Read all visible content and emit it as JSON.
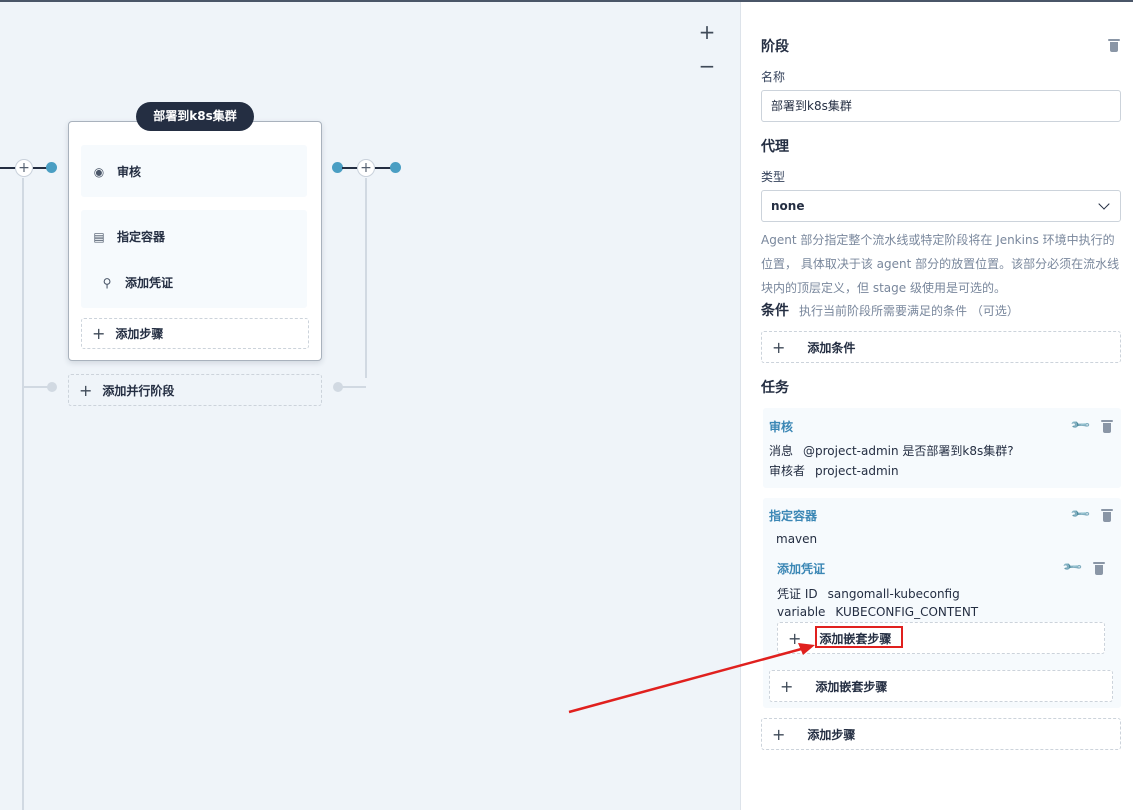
{
  "canvas": {
    "zoom_in": "+",
    "zoom_out": "−",
    "stage": {
      "title": "部署到k8s集群",
      "steps": [
        {
          "label": "审核",
          "icon": "review-icon"
        },
        {
          "label": "指定容器",
          "icon": "container-icon"
        },
        {
          "label": "添加凭证",
          "icon": "key-icon"
        }
      ],
      "add_step": "添加步骤"
    },
    "add_parallel_stage": "添加并行阶段"
  },
  "panel": {
    "section_stage": "阶段",
    "name_label": "名称",
    "name_value": "部署到k8s集群",
    "section_agent": "代理",
    "type_label": "类型",
    "type_value": "none",
    "agent_description": "Agent 部分指定整个流水线或特定阶段将在 Jenkins 环境中执行的位置， 具体取决于该 agent 部分的放置位置。该部分必须在流水线块内的顶层定义，但 stage 级使用是可选的。",
    "section_condition": "条件",
    "condition_hint": "执行当前阶段所需要满足的条件 （可选）",
    "add_condition": "添加条件",
    "section_tasks": "任务",
    "tasks": {
      "review": {
        "title": "审核",
        "message_key": "消息",
        "message_value": "@project-admin 是否部署到k8s集群?",
        "reviewer_key": "审核者",
        "reviewer_value": "project-admin"
      },
      "container": {
        "title": "指定容器",
        "name": "maven",
        "credential": {
          "title": "添加凭证",
          "id_key": "凭证 ID",
          "id_value": "sangomall-kubeconfig",
          "var_key": "variable",
          "var_value": "KUBECONFIG_CONTENT",
          "add_nested": "添加嵌套步骤"
        },
        "add_nested": "添加嵌套步骤"
      }
    },
    "add_step": "添加步骤"
  },
  "colors": {
    "accent": "#4a9ec3",
    "dark": "#242e42",
    "task_title": "#3b87b5",
    "annotation": "#e0201e"
  }
}
